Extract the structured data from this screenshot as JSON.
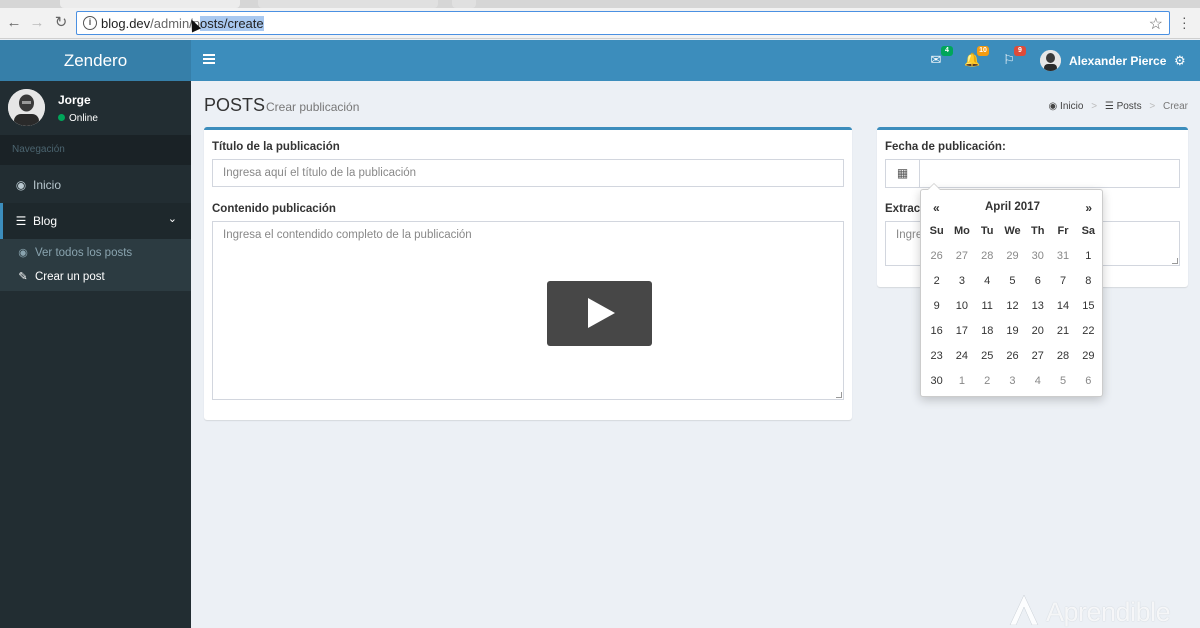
{
  "browser": {
    "url_domain": "blog.dev",
    "url_path_before": "/admin/p",
    "url_path_selected": "osts/create",
    "icons": {
      "back": "back-arrow-icon",
      "forward": "forward-arrow-icon",
      "reload": "reload-icon",
      "info": "info-icon",
      "bookmark": "star-icon",
      "menu": "kebab-menu-icon"
    }
  },
  "header": {
    "logo": "Zendero",
    "user_name": "Alexander Pierce",
    "notifications": [
      {
        "icon": "envelope-icon",
        "count": "4",
        "color": "#00a65a"
      },
      {
        "icon": "bell-icon",
        "count": "10",
        "color": "#f39c12"
      },
      {
        "icon": "flag-icon",
        "count": "9",
        "color": "#dd4b39"
      }
    ]
  },
  "sidebar": {
    "user_name": "Jorge",
    "user_status": "Online",
    "nav_header": "Navegación",
    "items": [
      {
        "label": "Inicio",
        "icon": "dashboard-icon"
      },
      {
        "label": "Blog",
        "icon": "list-icon"
      }
    ],
    "subitems": [
      {
        "label": "Ver todos los posts",
        "icon": "eye-icon"
      },
      {
        "label": "Crear un post",
        "icon": "pencil-icon"
      }
    ]
  },
  "page": {
    "title": "POSTS",
    "subtitle": "Crear publicación",
    "breadcrumb": [
      "Inicio",
      "Posts",
      "Crear"
    ]
  },
  "form": {
    "title_label": "Título de la publicación",
    "title_placeholder": "Ingresa aquí el título de la publicación",
    "content_label": "Contenido publicación",
    "content_placeholder": "Ingresa el contendido completo de la publicación",
    "date_label": "Fecha de publicación:",
    "excerpt_label": "Extract",
    "excerpt_placeholder": "Ingre"
  },
  "datepicker": {
    "month": "April 2017",
    "prev": "«",
    "next": "»",
    "days_of_week": [
      "Su",
      "Mo",
      "Tu",
      "We",
      "Th",
      "Fr",
      "Sa"
    ],
    "weeks": [
      [
        "26",
        "27",
        "28",
        "29",
        "30",
        "31",
        "1"
      ],
      [
        "2",
        "3",
        "4",
        "5",
        "6",
        "7",
        "8"
      ],
      [
        "9",
        "10",
        "11",
        "12",
        "13",
        "14",
        "15"
      ],
      [
        "16",
        "17",
        "18",
        "19",
        "20",
        "21",
        "22"
      ],
      [
        "23",
        "24",
        "25",
        "26",
        "27",
        "28",
        "29"
      ],
      [
        "30",
        "1",
        "2",
        "3",
        "4",
        "5",
        "6"
      ]
    ],
    "other_month": [
      [
        true,
        true,
        true,
        true,
        true,
        true,
        false
      ],
      [
        false,
        false,
        false,
        false,
        false,
        false,
        false
      ],
      [
        false,
        false,
        false,
        false,
        false,
        false,
        false
      ],
      [
        false,
        false,
        false,
        false,
        false,
        false,
        false
      ],
      [
        false,
        false,
        false,
        false,
        false,
        false,
        false
      ],
      [
        false,
        true,
        true,
        true,
        true,
        true,
        true
      ]
    ]
  },
  "watermark": "Aprendible",
  "colors": {
    "primary": "#3c8dbc",
    "sidebar": "#222d32"
  }
}
